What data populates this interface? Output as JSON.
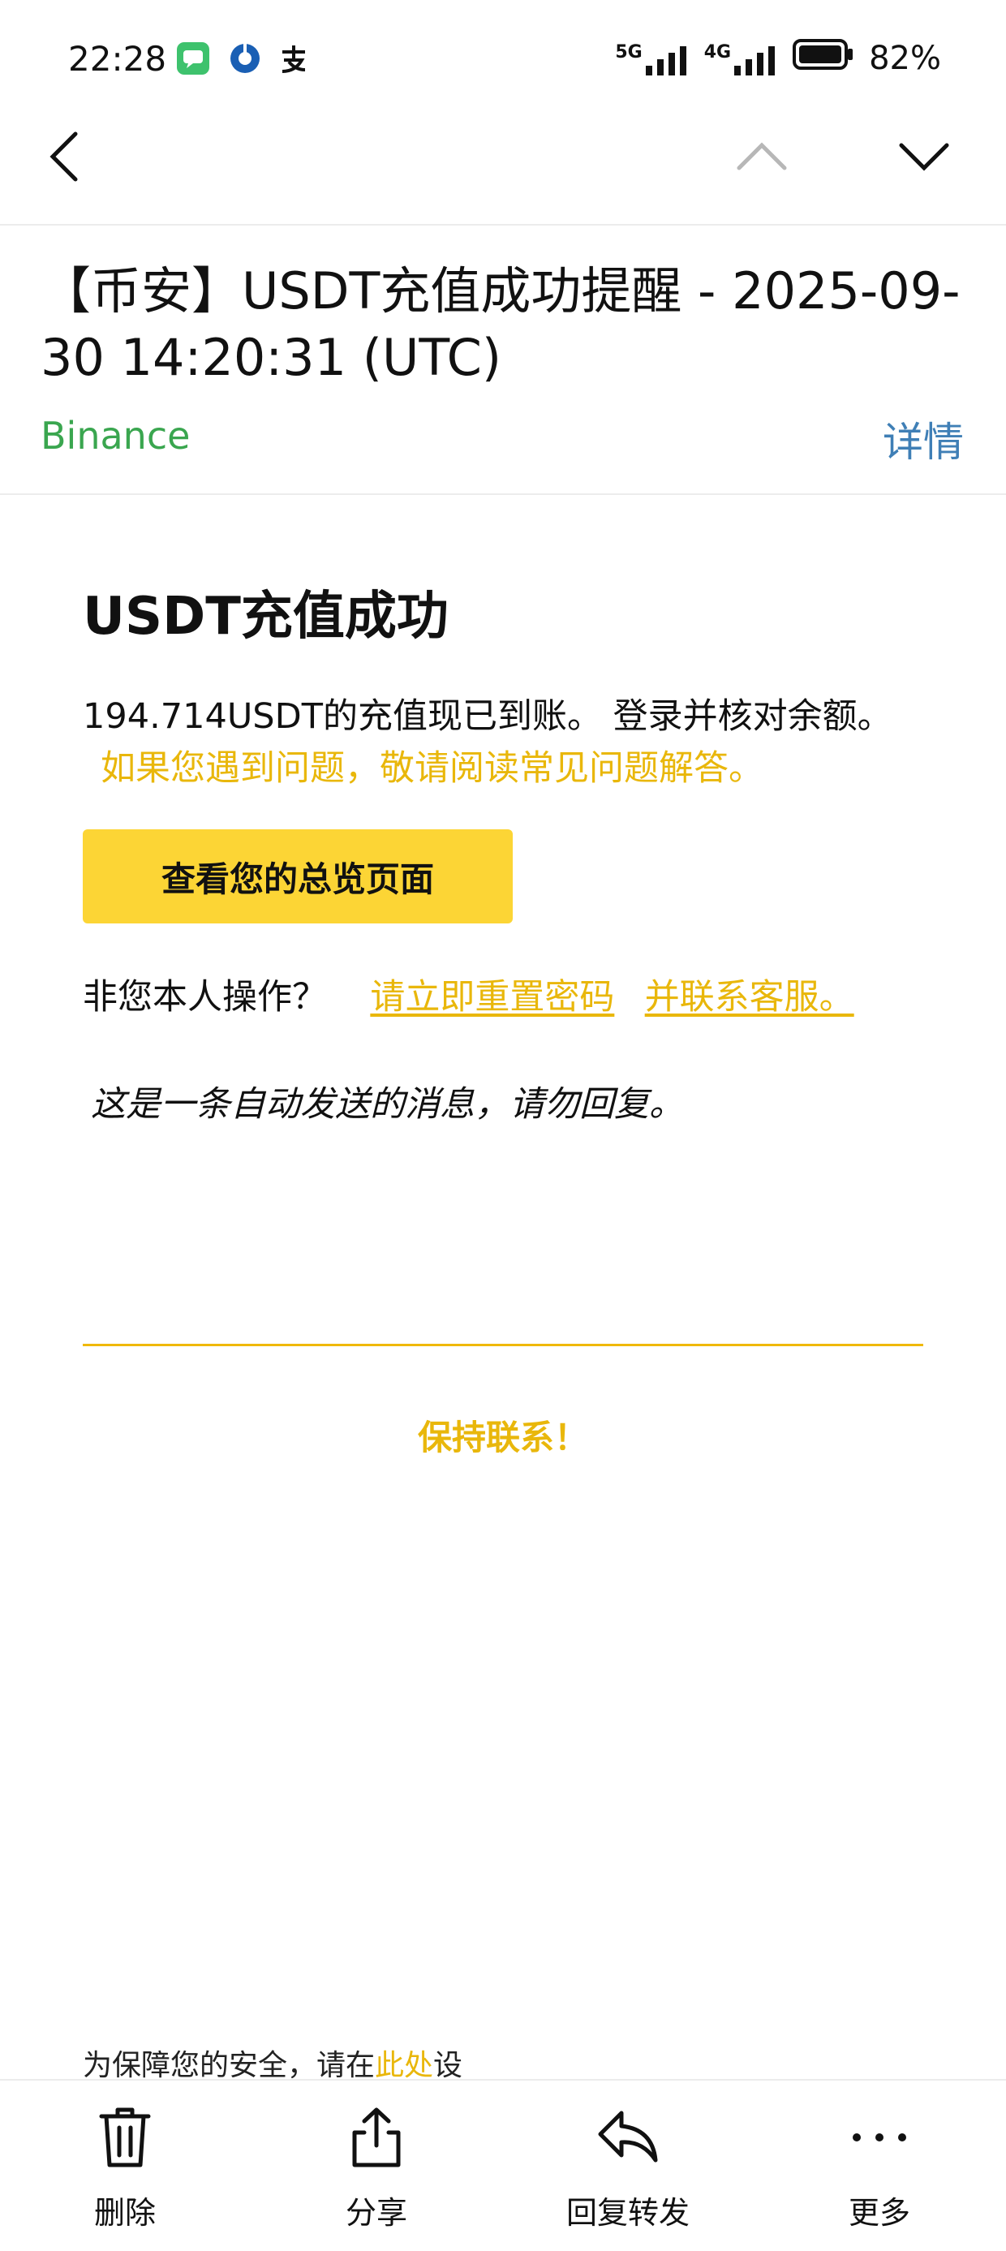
{
  "status_bar": {
    "time": "22:28",
    "network_1": "5G",
    "network_2": "4G",
    "battery": "82%"
  },
  "email": {
    "subject": "【币安】USDT充值成功提醒 - 2025-09-30 14:20:31 (UTC)",
    "sender": "Binance",
    "details_label": "详情"
  },
  "content": {
    "heading": "USDT充值成功",
    "message": "194.714USDT的充值现已到账。 登录并核对余额。",
    "faq_text": "如果您遇到问题，敬请阅读常见问题解答。",
    "cta_label": "查看您的总览页面",
    "not_you": "非您本人操作？",
    "reset_link": "请立即重置密码",
    "contact_link": "并联系客服。",
    "auto_note": "这是一条自动发送的消息，请勿回复。",
    "keep_in_touch": "保持联系！",
    "security_prefix": "为保障您的安全，请在",
    "security_link": "此处",
    "security_suffix": "设"
  },
  "toolbar": {
    "delete": "删除",
    "share": "分享",
    "reply_forward": "回复转发",
    "more": "更多"
  },
  "colors": {
    "accent_yellow": "#fcd535",
    "link_yellow": "#e9b70b",
    "sender_green": "#3aa64f",
    "details_blue": "#3f7fb6"
  }
}
